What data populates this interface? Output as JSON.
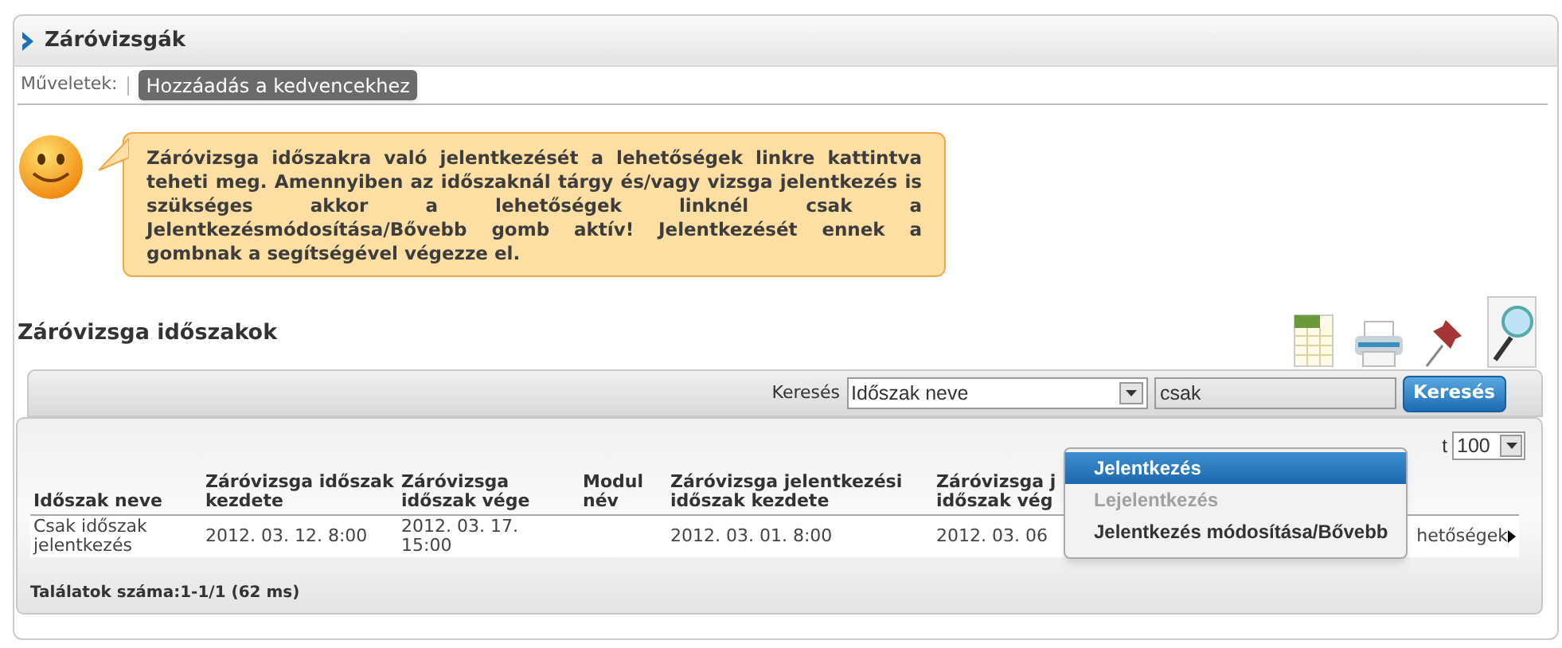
{
  "page": {
    "title": "Záróvizsgák"
  },
  "actions": {
    "label": "Műveletek:",
    "buttons": [
      "Hozzáadás a kedvencekhez"
    ]
  },
  "hint": {
    "text": "Záróvizsga időszakra való jelentkezését a lehetőségek linkre kattintva teheti meg. Amennyiben az időszaknál tárgy és/vagy vizsga jelentkezés is szükséges akkor a lehetőségek linknél csak a Jelentkezésmódosítása/Bővebb gomb aktív! Jelentkezését ennek a gombnak a segítségével végezze el."
  },
  "section": {
    "title": "Záróvizsga időszakok"
  },
  "search": {
    "label": "Keresés",
    "field": "Időszak neve",
    "query": "csak",
    "button": "Keresés"
  },
  "page_size": {
    "label": "t",
    "value": "100"
  },
  "table": {
    "columns": [
      "Időszak neve",
      "Záróvizsga időszak\nkezdete",
      "Záróvizsga\nidőszak vége",
      "Modul\nnév",
      "Záróvizsga jelentkezési\nidőszak kezdete",
      "Záróvizsga j\nidőszak vég"
    ],
    "rows": [
      {
        "cells": [
          "Csak időszak\njelentkezés",
          "2012. 03. 12. 8:00",
          "2012. 03. 17.\n15:00",
          null,
          "2012. 03. 01. 8:00",
          "2012. 03. 06",
          "hetőségek"
        ]
      }
    ]
  },
  "status": "Találatok száma:1-1/1 (62 ms)",
  "menu": {
    "items": [
      {
        "label": "Jelentkezés",
        "selected": true,
        "disabled": false
      },
      {
        "label": "Lejelentkezés",
        "selected": false,
        "disabled": true
      },
      {
        "label": "Jelentkezés módosítása/Bővebb",
        "selected": false,
        "disabled": false
      }
    ]
  }
}
